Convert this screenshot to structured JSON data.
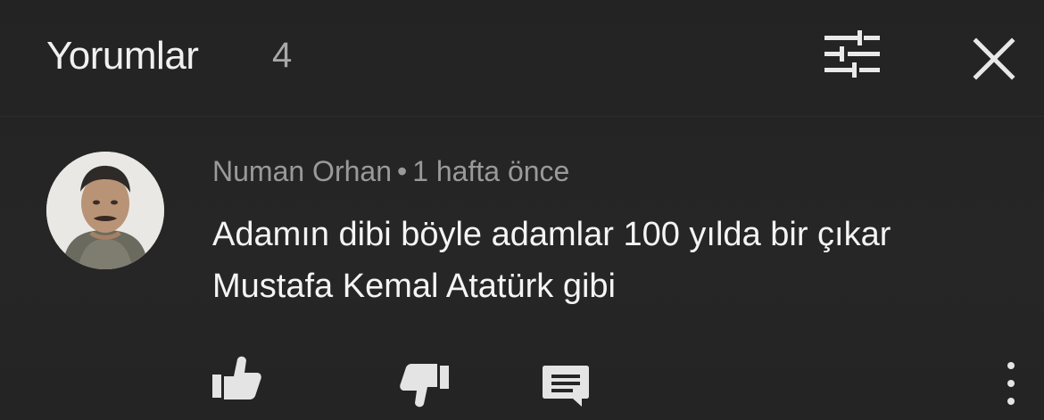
{
  "header": {
    "title": "Yorumlar",
    "count": "4"
  },
  "icons": {
    "filter": "sort-filter-icon",
    "close": "close-icon",
    "like": "thumbs-up-icon",
    "dislike": "thumbs-down-icon",
    "reply": "reply-comment-icon",
    "more": "more-vertical-icon"
  },
  "comment": {
    "author": "Numan Orhan",
    "separator": "•",
    "time": "1 hafta önce",
    "text": "Adamın dibi böyle adamlar 100 yılda bir çıkar Mustafa Kemal Atatürk gibi"
  },
  "colors": {
    "background": "#252525",
    "primary_text": "#f4f4f4",
    "secondary_text": "#9a9a9a"
  }
}
